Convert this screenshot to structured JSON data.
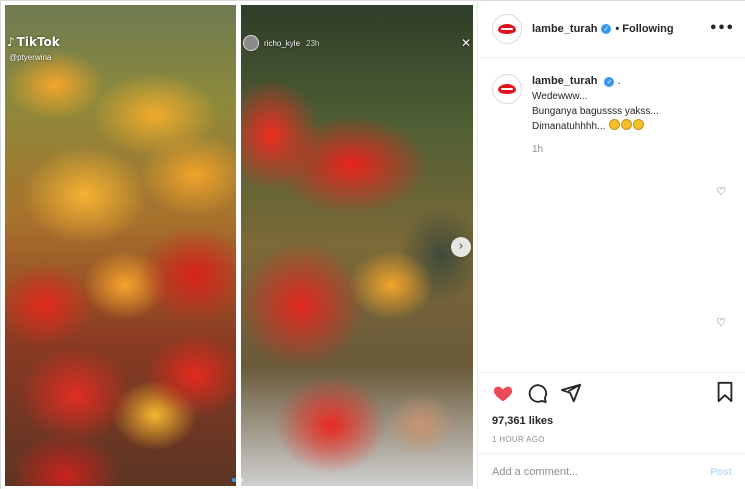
{
  "media": {
    "left_panel": {
      "watermark": "TikTok",
      "watermark_user": "@ptyerwina"
    },
    "right_panel": {
      "story_user": "richo_kyle",
      "story_time": "23h"
    },
    "next_arrow": "›",
    "close_glyph": "✕",
    "carousel": {
      "count": 2,
      "active_index": 1
    }
  },
  "header": {
    "username": "lambe_turah",
    "verified_glyph": "✓",
    "separator": "•",
    "follow_status": "Following",
    "more_glyph": "•••"
  },
  "caption": {
    "username": "lambe_turah",
    "verified_glyph": "✓",
    "trailing": ".",
    "lines": [
      "Wedewww...",
      "Bunganya bagussss yakss...",
      "Dimanatuhhhh..."
    ],
    "emoji_count": 3,
    "time": "1h"
  },
  "actions": {
    "liked": true,
    "like_color": "#ed4956",
    "likes": "97,361 likes",
    "posted": "1 HOUR AGO"
  },
  "comment_box": {
    "placeholder": "Add a comment...",
    "post_label": "Post"
  },
  "colors": {
    "verified": "#3897f0",
    "like": "#ed4956",
    "post_disabled": "#b2dffc"
  }
}
